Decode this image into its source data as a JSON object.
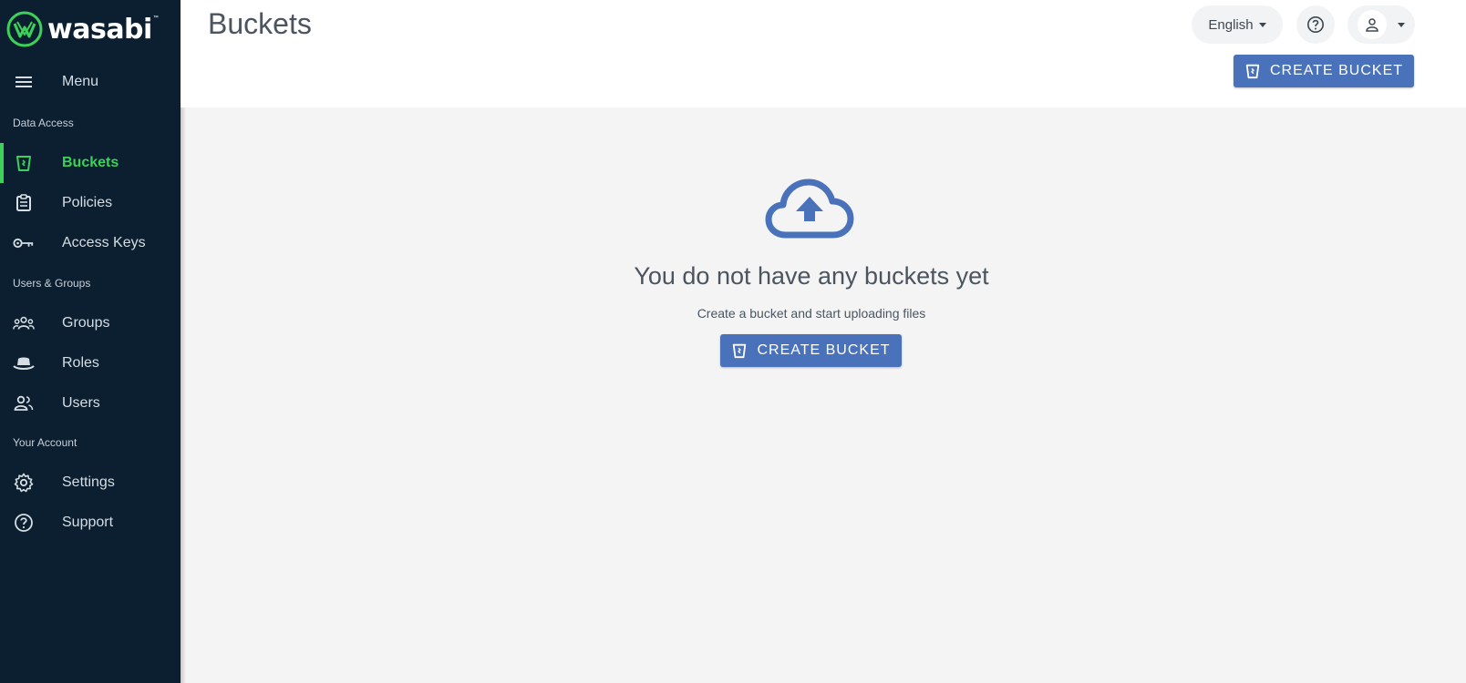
{
  "brand": {
    "name": "wasabi",
    "trademark": "™",
    "accent_color": "#3ed15a",
    "sidebar_bg": "#0b1f30",
    "primary_button_color": "#4a72ba"
  },
  "sidebar": {
    "menu_label": "Menu",
    "sections": [
      {
        "label": "Data Access"
      },
      {
        "label": "Users & Groups"
      },
      {
        "label": "Your Account"
      }
    ],
    "items": [
      {
        "label": "Buckets",
        "icon": "bucket-icon",
        "active": true
      },
      {
        "label": "Policies",
        "icon": "clipboard-icon",
        "active": false
      },
      {
        "label": "Access Keys",
        "icon": "key-icon",
        "active": false
      },
      {
        "label": "Groups",
        "icon": "groups-icon",
        "active": false
      },
      {
        "label": "Roles",
        "icon": "hat-icon",
        "active": false
      },
      {
        "label": "Users",
        "icon": "users-icon",
        "active": false
      },
      {
        "label": "Settings",
        "icon": "gear-icon",
        "active": false
      },
      {
        "label": "Support",
        "icon": "help-circle-icon",
        "active": false
      }
    ]
  },
  "header": {
    "title": "Buckets",
    "language": "English",
    "help_icon": "help-circle-icon",
    "user_icon": "person-icon",
    "create_button_label": "CREATE BUCKET"
  },
  "empty_state": {
    "icon": "cloud-upload-icon",
    "title": "You do not have any buckets yet",
    "subtitle": "Create a bucket and start uploading files",
    "button_label": "CREATE BUCKET"
  }
}
